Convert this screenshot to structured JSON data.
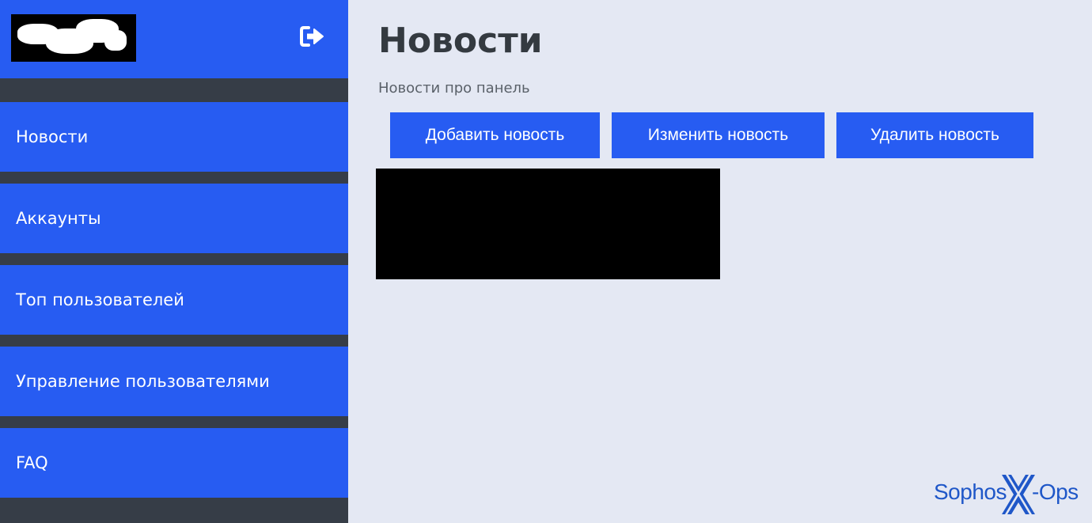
{
  "sidebar": {
    "logout_icon": "sign-out-icon",
    "items": [
      {
        "label": "Новости"
      },
      {
        "label": "Аккаунты"
      },
      {
        "label": "Топ пользователей"
      },
      {
        "label": "Управление пользователями"
      },
      {
        "label": "FAQ"
      }
    ]
  },
  "main": {
    "title": "Новости",
    "subtitle": "Новости про панель",
    "buttons": {
      "add": "Добавить новость",
      "edit": "Изменить новость",
      "delete": "Удалить новость"
    }
  },
  "watermark": {
    "text_left": "Sophos",
    "text_mid": "X",
    "text_right": "-Ops"
  },
  "colors": {
    "accent": "#275cf2",
    "sidebar_bg": "#363d47",
    "page_bg": "#e4e8f3",
    "title": "#343a40"
  }
}
